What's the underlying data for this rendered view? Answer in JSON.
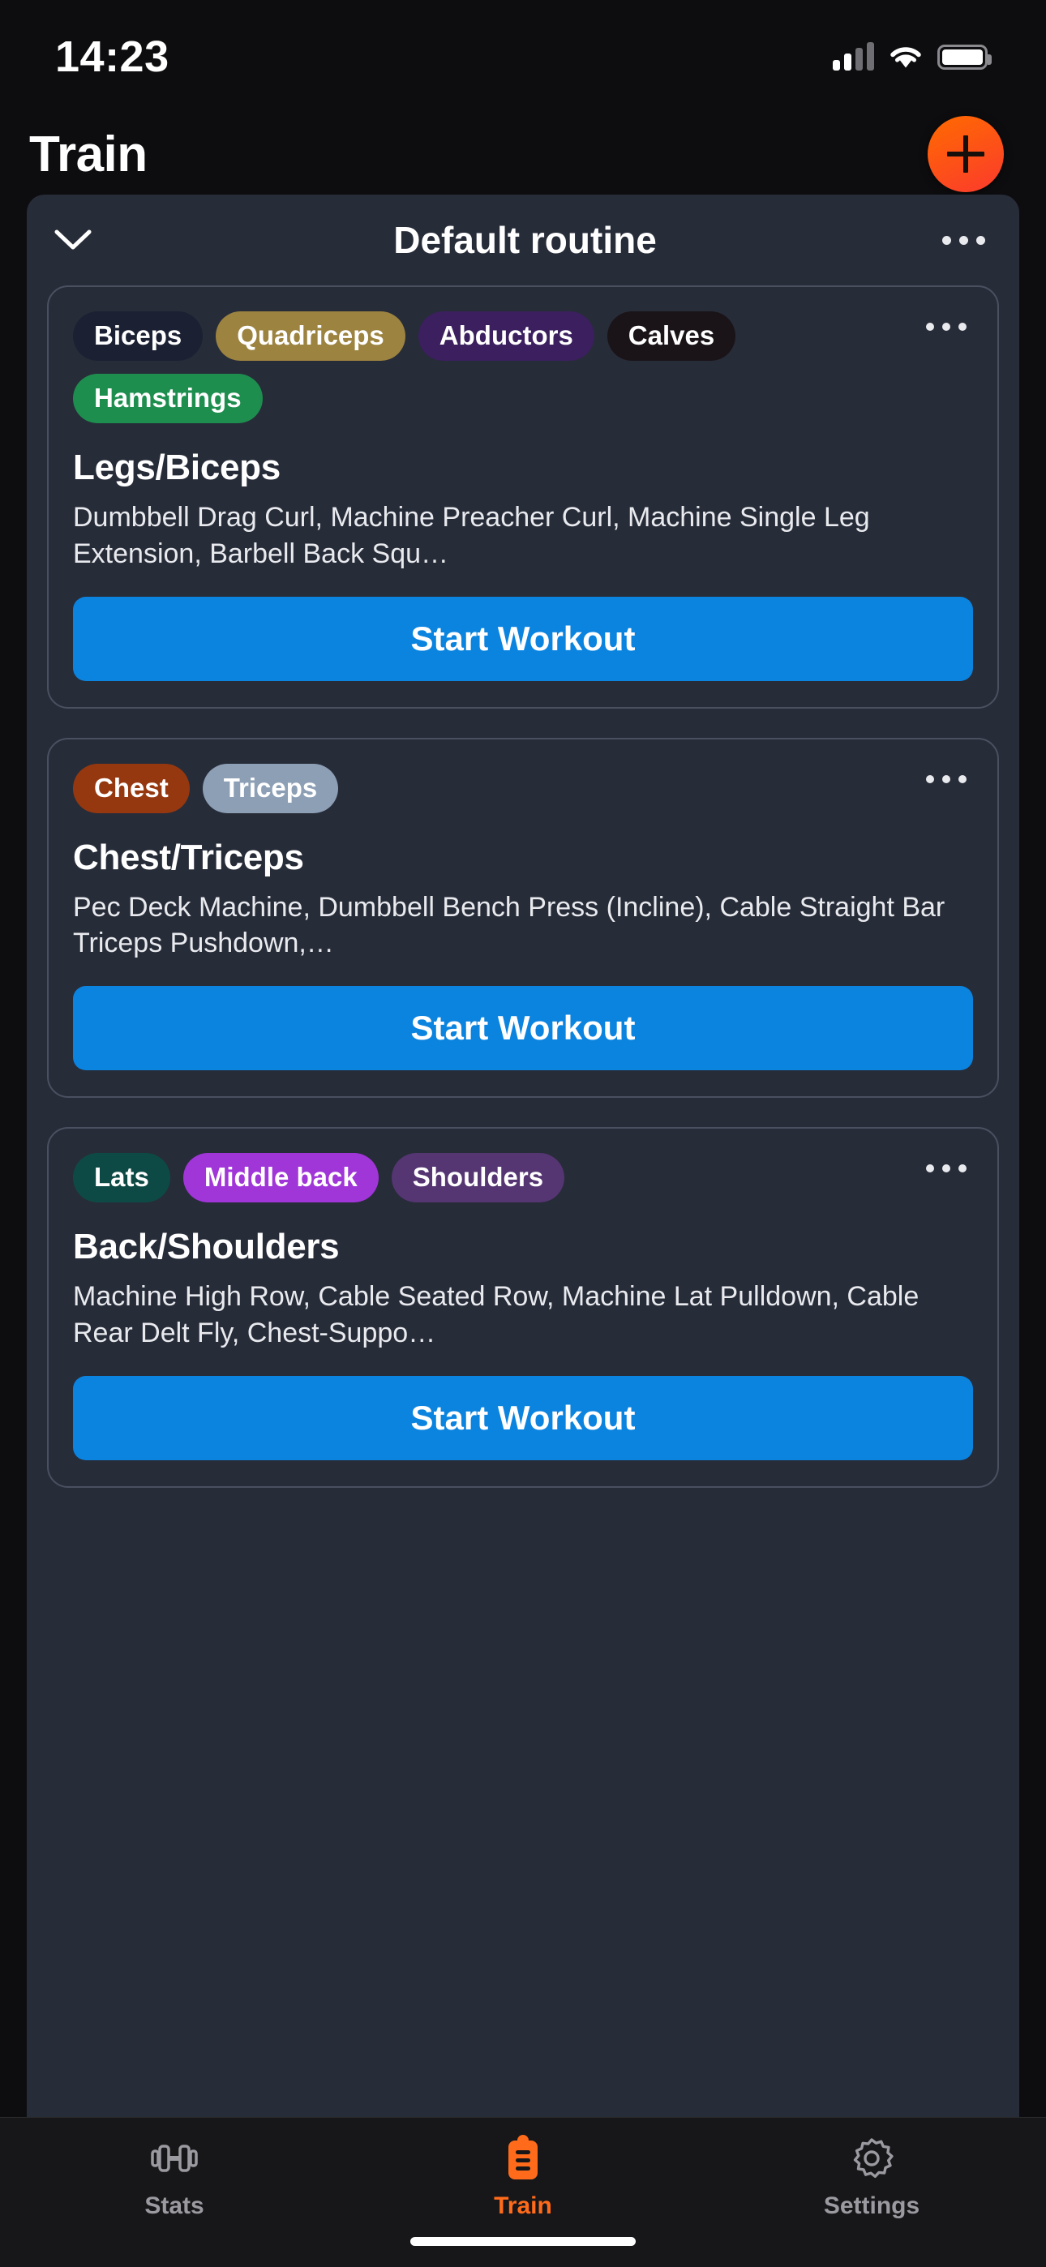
{
  "status_bar": {
    "time": "14:23",
    "signal_icon": "cellular-signal-icon",
    "wifi_icon": "wifi-icon",
    "battery_icon": "battery-full-icon"
  },
  "header": {
    "title": "Train",
    "add_button_icon": "plus-icon",
    "accent_color": "#ff6b00"
  },
  "routine": {
    "collapse_icon": "chevron-down-icon",
    "title": "Default routine",
    "menu_icon": "more-options-icon"
  },
  "workouts": [
    {
      "tags": [
        {
          "label": "Biceps",
          "color": "#1b2133"
        },
        {
          "label": "Quadriceps",
          "color": "#9c8340"
        },
        {
          "label": "Abductors",
          "color": "#3b1f5e"
        },
        {
          "label": "Calves",
          "color": "#1a1418"
        },
        {
          "label": "Hamstrings",
          "color": "#1e8e4f"
        }
      ],
      "title": "Legs/Biceps",
      "exercises": "Dumbbell Drag Curl, Machine Preacher Curl, Machine Single Leg Extension, Barbell Back Squ…",
      "start_label": "Start Workout",
      "menu_icon": "more-options-icon"
    },
    {
      "tags": [
        {
          "label": "Chest",
          "color": "#96380f"
        },
        {
          "label": "Triceps",
          "color": "#8d9fb5"
        }
      ],
      "title": "Chest/Triceps",
      "exercises": "Pec Deck Machine, Dumbbell Bench Press (Incline), Cable Straight Bar Triceps Pushdown,…",
      "start_label": "Start Workout",
      "menu_icon": "more-options-icon"
    },
    {
      "tags": [
        {
          "label": "Lats",
          "color": "#0e4a45"
        },
        {
          "label": "Middle back",
          "color": "#a035d8"
        },
        {
          "label": "Shoulders",
          "color": "#553572"
        }
      ],
      "title": "Back/Shoulders",
      "exercises": "Machine High Row, Cable Seated Row, Machine Lat Pulldown, Cable Rear Delt Fly, Chest-Suppo…",
      "start_label": "Start Workout",
      "menu_icon": "more-options-icon"
    }
  ],
  "start_button_color": "#0b84e0",
  "tabbar": {
    "items": [
      {
        "label": "Stats",
        "icon": "dumbbell-icon",
        "active": false
      },
      {
        "label": "Train",
        "icon": "clipboard-icon",
        "active": true
      },
      {
        "label": "Settings",
        "icon": "gear-icon",
        "active": false
      }
    ],
    "active_color": "#ff6b1a",
    "inactive_color": "#9a9aa0"
  }
}
